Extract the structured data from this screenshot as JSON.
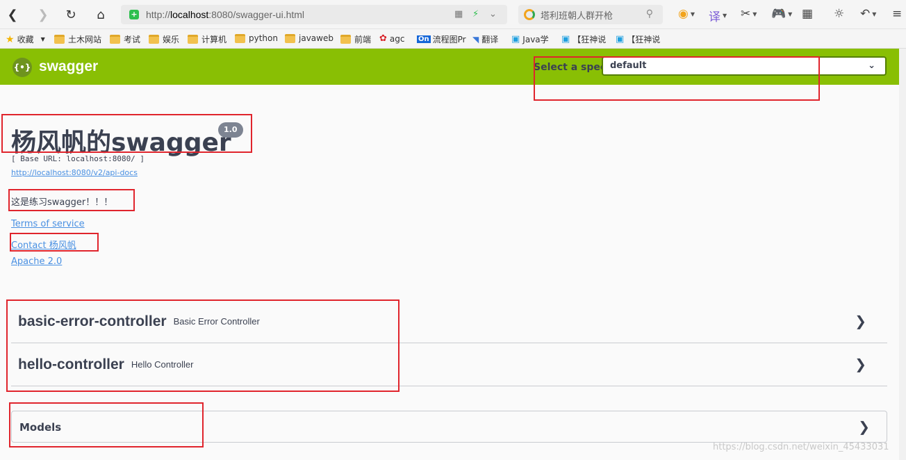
{
  "browser": {
    "url_prefix": "http://",
    "url_host": "localhost",
    "url_rest": ":8080/swagger-ui.html",
    "search_placeholder": "塔利班朝人群开枪"
  },
  "bookmarks": [
    {
      "label": "收藏",
      "icon": "star-icon"
    },
    {
      "label": "土木网站",
      "icon": "folder-icon"
    },
    {
      "label": "考试",
      "icon": "folder-icon"
    },
    {
      "label": "娱乐",
      "icon": "folder-icon"
    },
    {
      "label": "计算机",
      "icon": "folder-icon"
    },
    {
      "label": "python",
      "icon": "folder-icon"
    },
    {
      "label": "javaweb",
      "icon": "folder-icon"
    },
    {
      "label": "前端",
      "icon": "folder-icon"
    },
    {
      "label": "agc",
      "icon": "huawei-icon"
    },
    {
      "label": "流程图Pr",
      "icon": "on-icon"
    },
    {
      "label": "翻译",
      "icon": "translate-icon"
    },
    {
      "label": "Java学",
      "icon": "bilibili-icon"
    },
    {
      "label": "【狂神说",
      "icon": "bilibili-icon"
    },
    {
      "label": "【狂神说",
      "icon": "bilibili-icon"
    }
  ],
  "swagger": {
    "logo_text": "swagger",
    "spec_label": "Select a spec",
    "spec_value": "default"
  },
  "info": {
    "title": "杨风帆的swagger",
    "version": "1.0",
    "base_url": "[ Base URL: localhost:8080/ ]",
    "api_docs": "http://localhost:8080/v2/api-docs",
    "description": "这是练习swagger！！！",
    "terms": "Terms of service",
    "contact": "Contact 杨风帆",
    "license": "Apache 2.0"
  },
  "controllers": [
    {
      "name": "basic-error-controller",
      "description": "Basic Error Controller"
    },
    {
      "name": "hello-controller",
      "description": "Hello Controller"
    }
  ],
  "models_label": "Models",
  "watermark": "https://blog.csdn.net/weixin_45433031",
  "colors": {
    "topbar": "#89bf04",
    "annotation": "#e0242c",
    "link": "#4990e2"
  }
}
